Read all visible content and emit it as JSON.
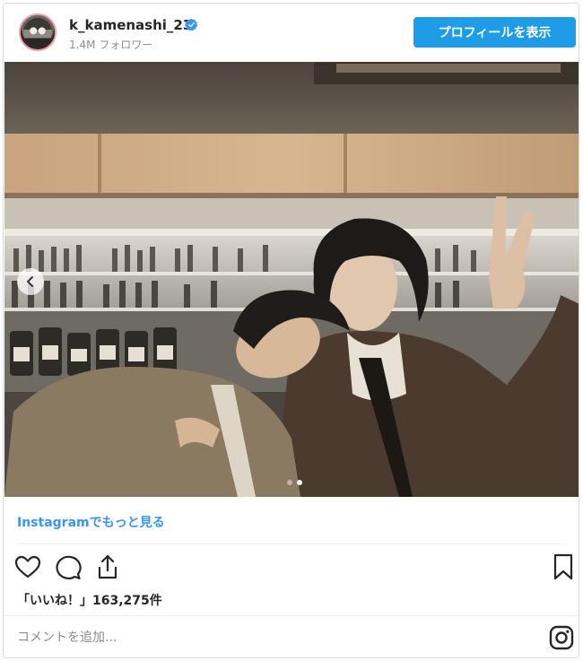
{
  "header": {
    "username": "k_kamenashi_23",
    "verified_icon": "verified-badge-icon",
    "followers": "1.4M フォロワー",
    "profile_button_label": "プロフィールを表示"
  },
  "media": {
    "carousel_total": 2,
    "carousel_active": 2,
    "prev_icon": "chevron-left-icon"
  },
  "more_link_label": "Instagramでもっと見る",
  "actions": {
    "like_icon": "heart-icon",
    "comment_icon": "comment-icon",
    "share_icon": "share-icon",
    "save_icon": "bookmark-icon"
  },
  "likes_text": "「いいね！」163,275件",
  "comment": {
    "placeholder": "コメントを追加..."
  },
  "colors": {
    "accent": "#1e9ce6",
    "link": "#3897f0",
    "muted": "#8e8e8e",
    "verified": "#3897f0"
  }
}
